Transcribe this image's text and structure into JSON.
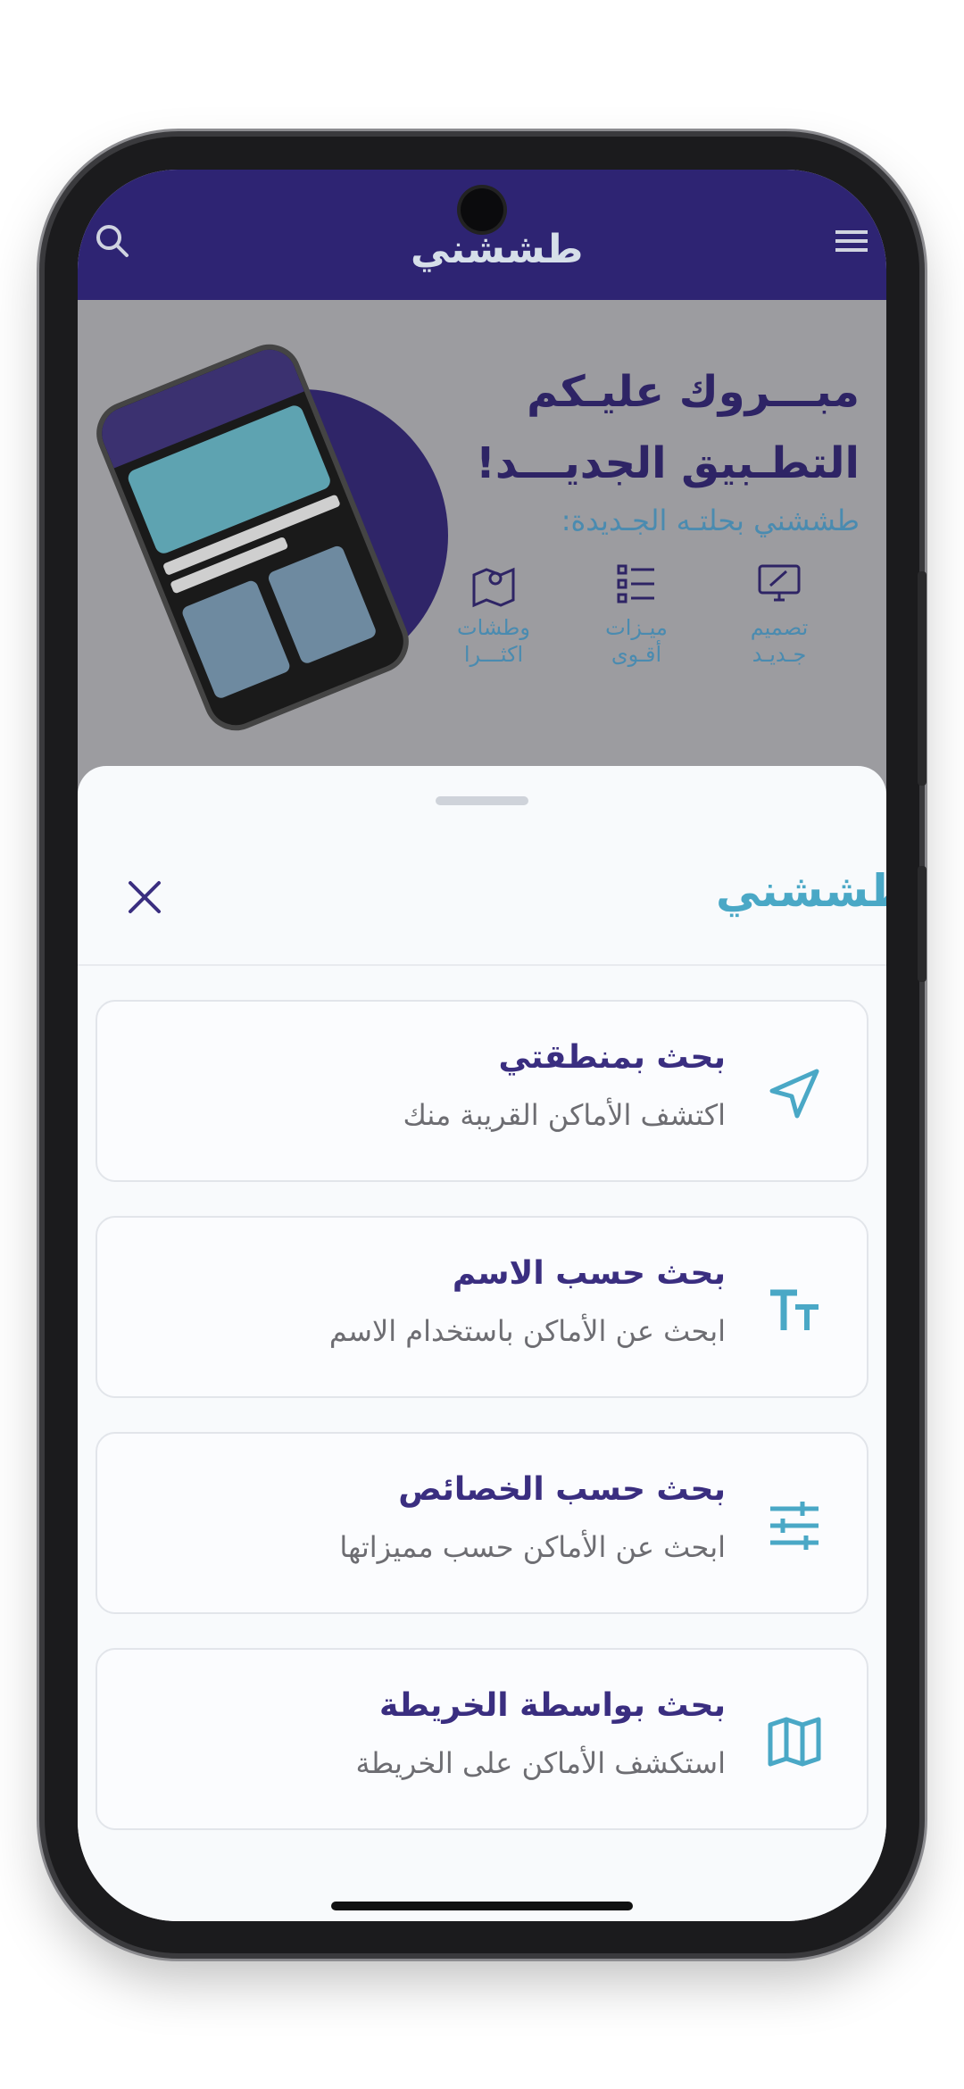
{
  "header": {
    "logo_text": "طششني",
    "search_icon": "search-icon",
    "menu_icon": "hamburger-menu-icon"
  },
  "banner": {
    "line1": "مبـــروك عليـكم",
    "line2": "التطـبيق الجديـــد!",
    "line3": "طششني بحلتـه الجـديدة:",
    "features": [
      {
        "label": "تصميم جـديـد",
        "icon": "monitor-design-icon"
      },
      {
        "label": "ميـزات أقـوى",
        "icon": "checklist-icon"
      },
      {
        "label": "وطشات اكثـــرا",
        "icon": "map-location-icon"
      }
    ],
    "circle_color": "#2f2568"
  },
  "sheet": {
    "logo_text": "طششني",
    "close_icon": "close-icon",
    "options": [
      {
        "title": "بحث بمنطقتي",
        "subtitle": "اكتشف الأماكن القريبة منك",
        "icon": "navigation-arrow-icon"
      },
      {
        "title": "بحث حسب الاسم",
        "subtitle": "ابحث عن الأماكن باستخدام الاسم",
        "icon": "text-size-icon"
      },
      {
        "title": "بحث حسب الخصائص",
        "subtitle": "ابحث عن الأماكن حسب مميزاتها",
        "icon": "sliders-icon"
      },
      {
        "title": "بحث بواسطة الخريطة",
        "subtitle": "استكشف الأماكن على الخريطة",
        "icon": "map-icon"
      }
    ]
  },
  "colors": {
    "brand_purple": "#2e2473",
    "accent_blue": "#4aa8c6",
    "title_purple": "#3a2e80"
  }
}
